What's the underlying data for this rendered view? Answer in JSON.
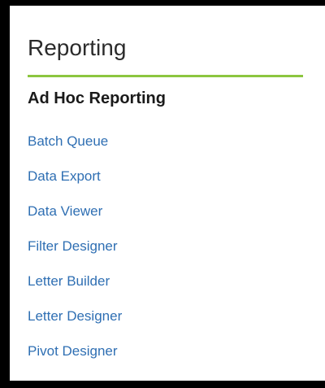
{
  "panel": {
    "title": "Reporting",
    "accent_color": "#8cc63f",
    "link_color": "#2f6fb3",
    "group": {
      "heading": "Ad Hoc Reporting",
      "links": [
        {
          "label": "Batch Queue"
        },
        {
          "label": "Data Export"
        },
        {
          "label": "Data Viewer"
        },
        {
          "label": "Filter Designer"
        },
        {
          "label": "Letter Builder"
        },
        {
          "label": "Letter Designer"
        },
        {
          "label": "Pivot Designer"
        }
      ]
    }
  }
}
